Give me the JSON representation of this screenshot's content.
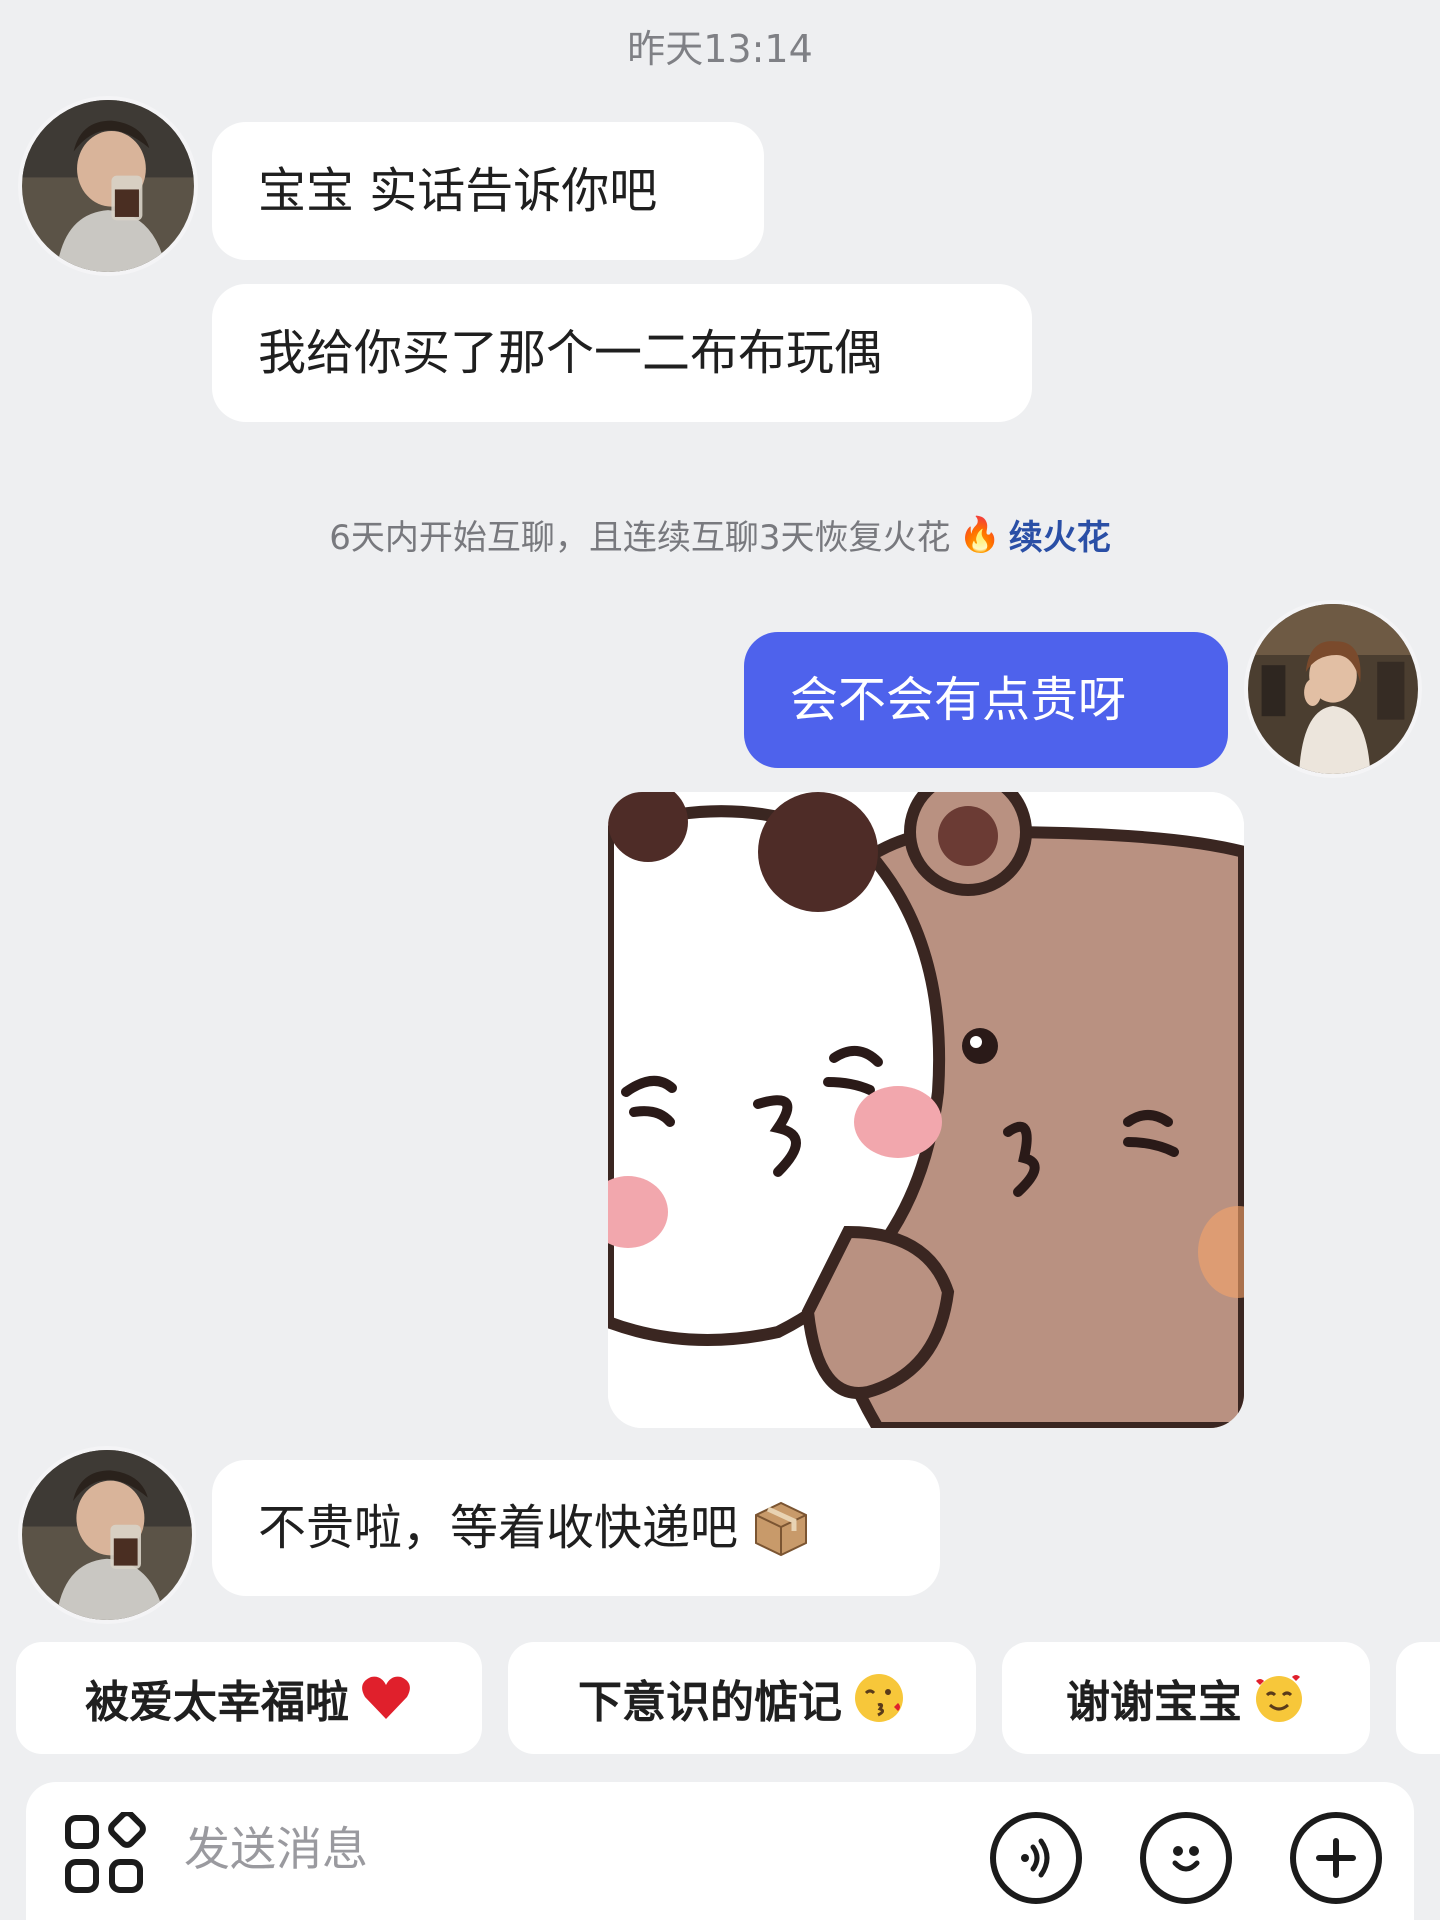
{
  "header": {
    "timestamp": "昨天13:14"
  },
  "messages": [
    {
      "id": "m1",
      "side": "left",
      "text": "宝宝 实话告诉你吧"
    },
    {
      "id": "m2",
      "side": "left",
      "text": "我给你买了那个一二布布玩偶"
    },
    {
      "id": "m3",
      "side": "right",
      "text": "会不会有点贵呀"
    },
    {
      "id": "m4",
      "side": "right",
      "type": "sticker",
      "icon": "bubu-dudu-kiss-sticker"
    },
    {
      "id": "m5",
      "side": "left",
      "text": "不贵啦，等着收快递吧",
      "icon": "package-box-icon"
    }
  ],
  "system_tip": {
    "text": "6天内开始互聊，且连续互聊3天恢复火花",
    "emoji": "🔥",
    "action_label": "续火花"
  },
  "quick_replies": [
    {
      "label": "被爱太幸福啦",
      "icon": "red-heart-icon"
    },
    {
      "label": "下意识的惦记",
      "icon": "kiss-face-icon"
    },
    {
      "label": "谢谢宝宝",
      "icon": "smiling-hearts-face-icon"
    }
  ],
  "input_bar": {
    "placeholder": "发送消息",
    "icons": [
      "apps-icon",
      "voice-icon",
      "emoji-icon",
      "plus-icon"
    ]
  },
  "colors": {
    "background": "#eeeff1",
    "sent_bubble": "#4e62ec",
    "received_bubble": "#ffffff",
    "link": "#2a4fa6"
  }
}
